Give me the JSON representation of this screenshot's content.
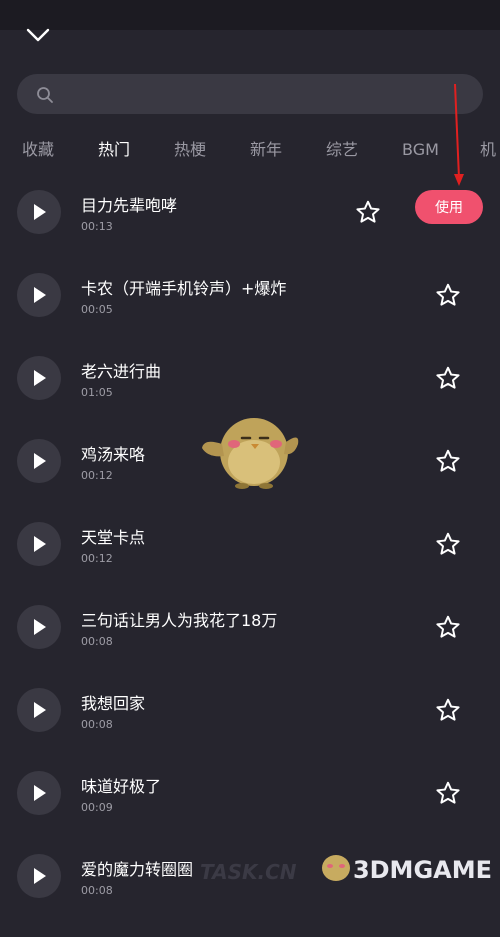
{
  "search": {
    "placeholder": ""
  },
  "tabs": [
    {
      "label": "收藏"
    },
    {
      "label": "热门"
    },
    {
      "label": "热梗"
    },
    {
      "label": "新年"
    },
    {
      "label": "综艺"
    },
    {
      "label": "BGM"
    },
    {
      "label": "机"
    }
  ],
  "active_tab": "热门",
  "use_label": "使用",
  "songs": [
    {
      "title": "目力先辈咆哮",
      "duration": "00:13"
    },
    {
      "title": "卡农（开端手机铃声）+爆炸",
      "duration": "00:05"
    },
    {
      "title": "老六进行曲",
      "duration": "01:05"
    },
    {
      "title": "鸡汤来咯",
      "duration": "00:12"
    },
    {
      "title": "天堂卡点",
      "duration": "00:12"
    },
    {
      "title": "三句话让男人为我花了18万",
      "duration": "00:08"
    },
    {
      "title": "我想回家",
      "duration": "00:08"
    },
    {
      "title": "味道好极了",
      "duration": "00:09"
    },
    {
      "title": "爱的魔力转圈圈",
      "duration": "00:08"
    }
  ],
  "watermark": {
    "site": "TASK.CN",
    "brand": "3DMGAME"
  },
  "colors": {
    "background": "#26252e",
    "accent": "#f0516e",
    "annotation": "#e02020"
  }
}
